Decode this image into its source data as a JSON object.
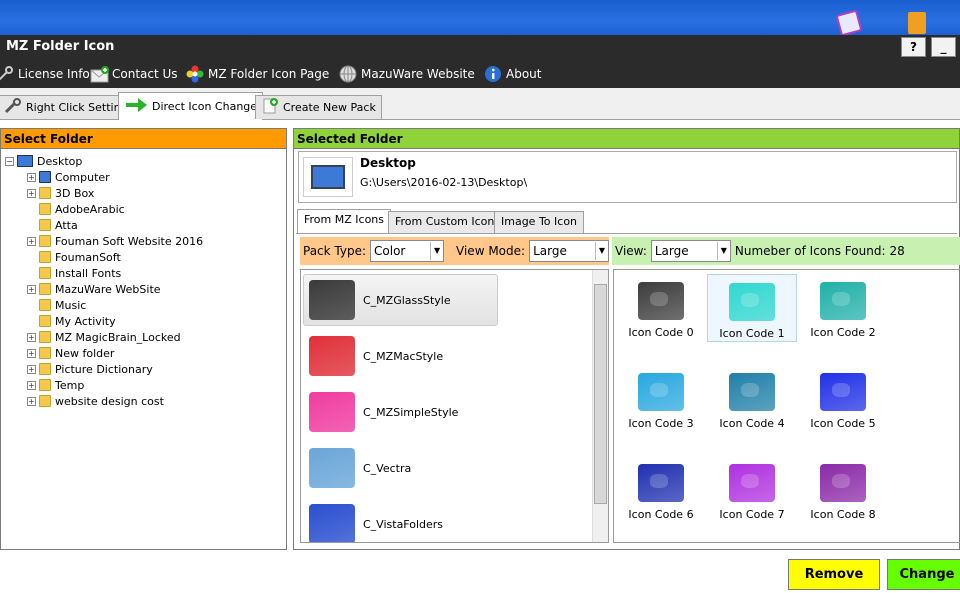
{
  "window": {
    "title": "MZ Folder Icon",
    "help_label": "?",
    "minimize_label": "_"
  },
  "menu": [
    {
      "label": "License Info",
      "icon": "key-icon"
    },
    {
      "label": "Contact Us",
      "icon": "mail-icon"
    },
    {
      "label": "MZ Folder Icon Page",
      "icon": "flower-icon"
    },
    {
      "label": "MazuWare Website",
      "icon": "globe-icon"
    },
    {
      "label": "About",
      "icon": "info-icon"
    }
  ],
  "tabs": [
    {
      "label": "Right Click Settings",
      "icon": "wrench-icon"
    },
    {
      "label": "Direct Icon Change",
      "icon": "arrow-right-icon"
    },
    {
      "label": "Create New Pack",
      "icon": "new-pack-icon"
    }
  ],
  "select_folder": {
    "title": "Select Folder",
    "root": "Desktop",
    "items": [
      "Computer",
      "3D Box",
      "AdobeArabic",
      "Atta",
      "Fouman Soft Website 2016",
      "FoumanSoft",
      "Install Fonts",
      "MazuWare WebSite",
      "Music",
      "My Activity",
      "MZ MagicBrain_Locked",
      "New folder",
      "Picture Dictionary",
      "Temp",
      "website design cost"
    ]
  },
  "selected_folder": {
    "title": "Selected Folder",
    "name": "Desktop",
    "path": "G:\\Users\\2016-02-13\\Desktop\\"
  },
  "subtabs": [
    "From MZ Icons",
    "From Custom Icon",
    "Image To Icon"
  ],
  "options": {
    "pack_type_label": "Pack Type:",
    "pack_type_value": "Color",
    "view_mode_label": "View Mode:",
    "view_mode_value": "Large",
    "view_label": "View:",
    "view_value": "Large",
    "count_label": "Numeber of Icons Found:",
    "count_value": "28"
  },
  "packs": [
    {
      "label": "C_MZGlassStyle",
      "color": "#3a3a3a"
    },
    {
      "label": "C_MZMacStyle",
      "color": "#e0303a"
    },
    {
      "label": "C_MZSimpleStyle",
      "color": "#f03ca0"
    },
    {
      "label": "C_Vectra",
      "color": "#6aa6d8"
    },
    {
      "label": "C_VistaFolders",
      "color": "#2a4fd0"
    }
  ],
  "icons": [
    {
      "label": "Icon Code 0",
      "color": "#3c3c3c"
    },
    {
      "label": "Icon Code 1",
      "color": "#30d8d0"
    },
    {
      "label": "Icon Code 2",
      "color": "#20b0a8"
    },
    {
      "label": "Icon Code 3",
      "color": "#28a8e0"
    },
    {
      "label": "Icon Code 4",
      "color": "#2080a8"
    },
    {
      "label": "Icon Code 5",
      "color": "#2030e8"
    },
    {
      "label": "Icon Code 6",
      "color": "#2030b0"
    },
    {
      "label": "Icon Code 7",
      "color": "#b030e0"
    },
    {
      "label": "Icon Code 8",
      "color": "#8a2aa8"
    }
  ],
  "buttons": {
    "remove": "Remove",
    "change": "Change"
  },
  "colors": {
    "orange": "#ff9a00",
    "green": "#8fd23a",
    "yellow": "#ffff00",
    "lime": "#66ff00"
  }
}
